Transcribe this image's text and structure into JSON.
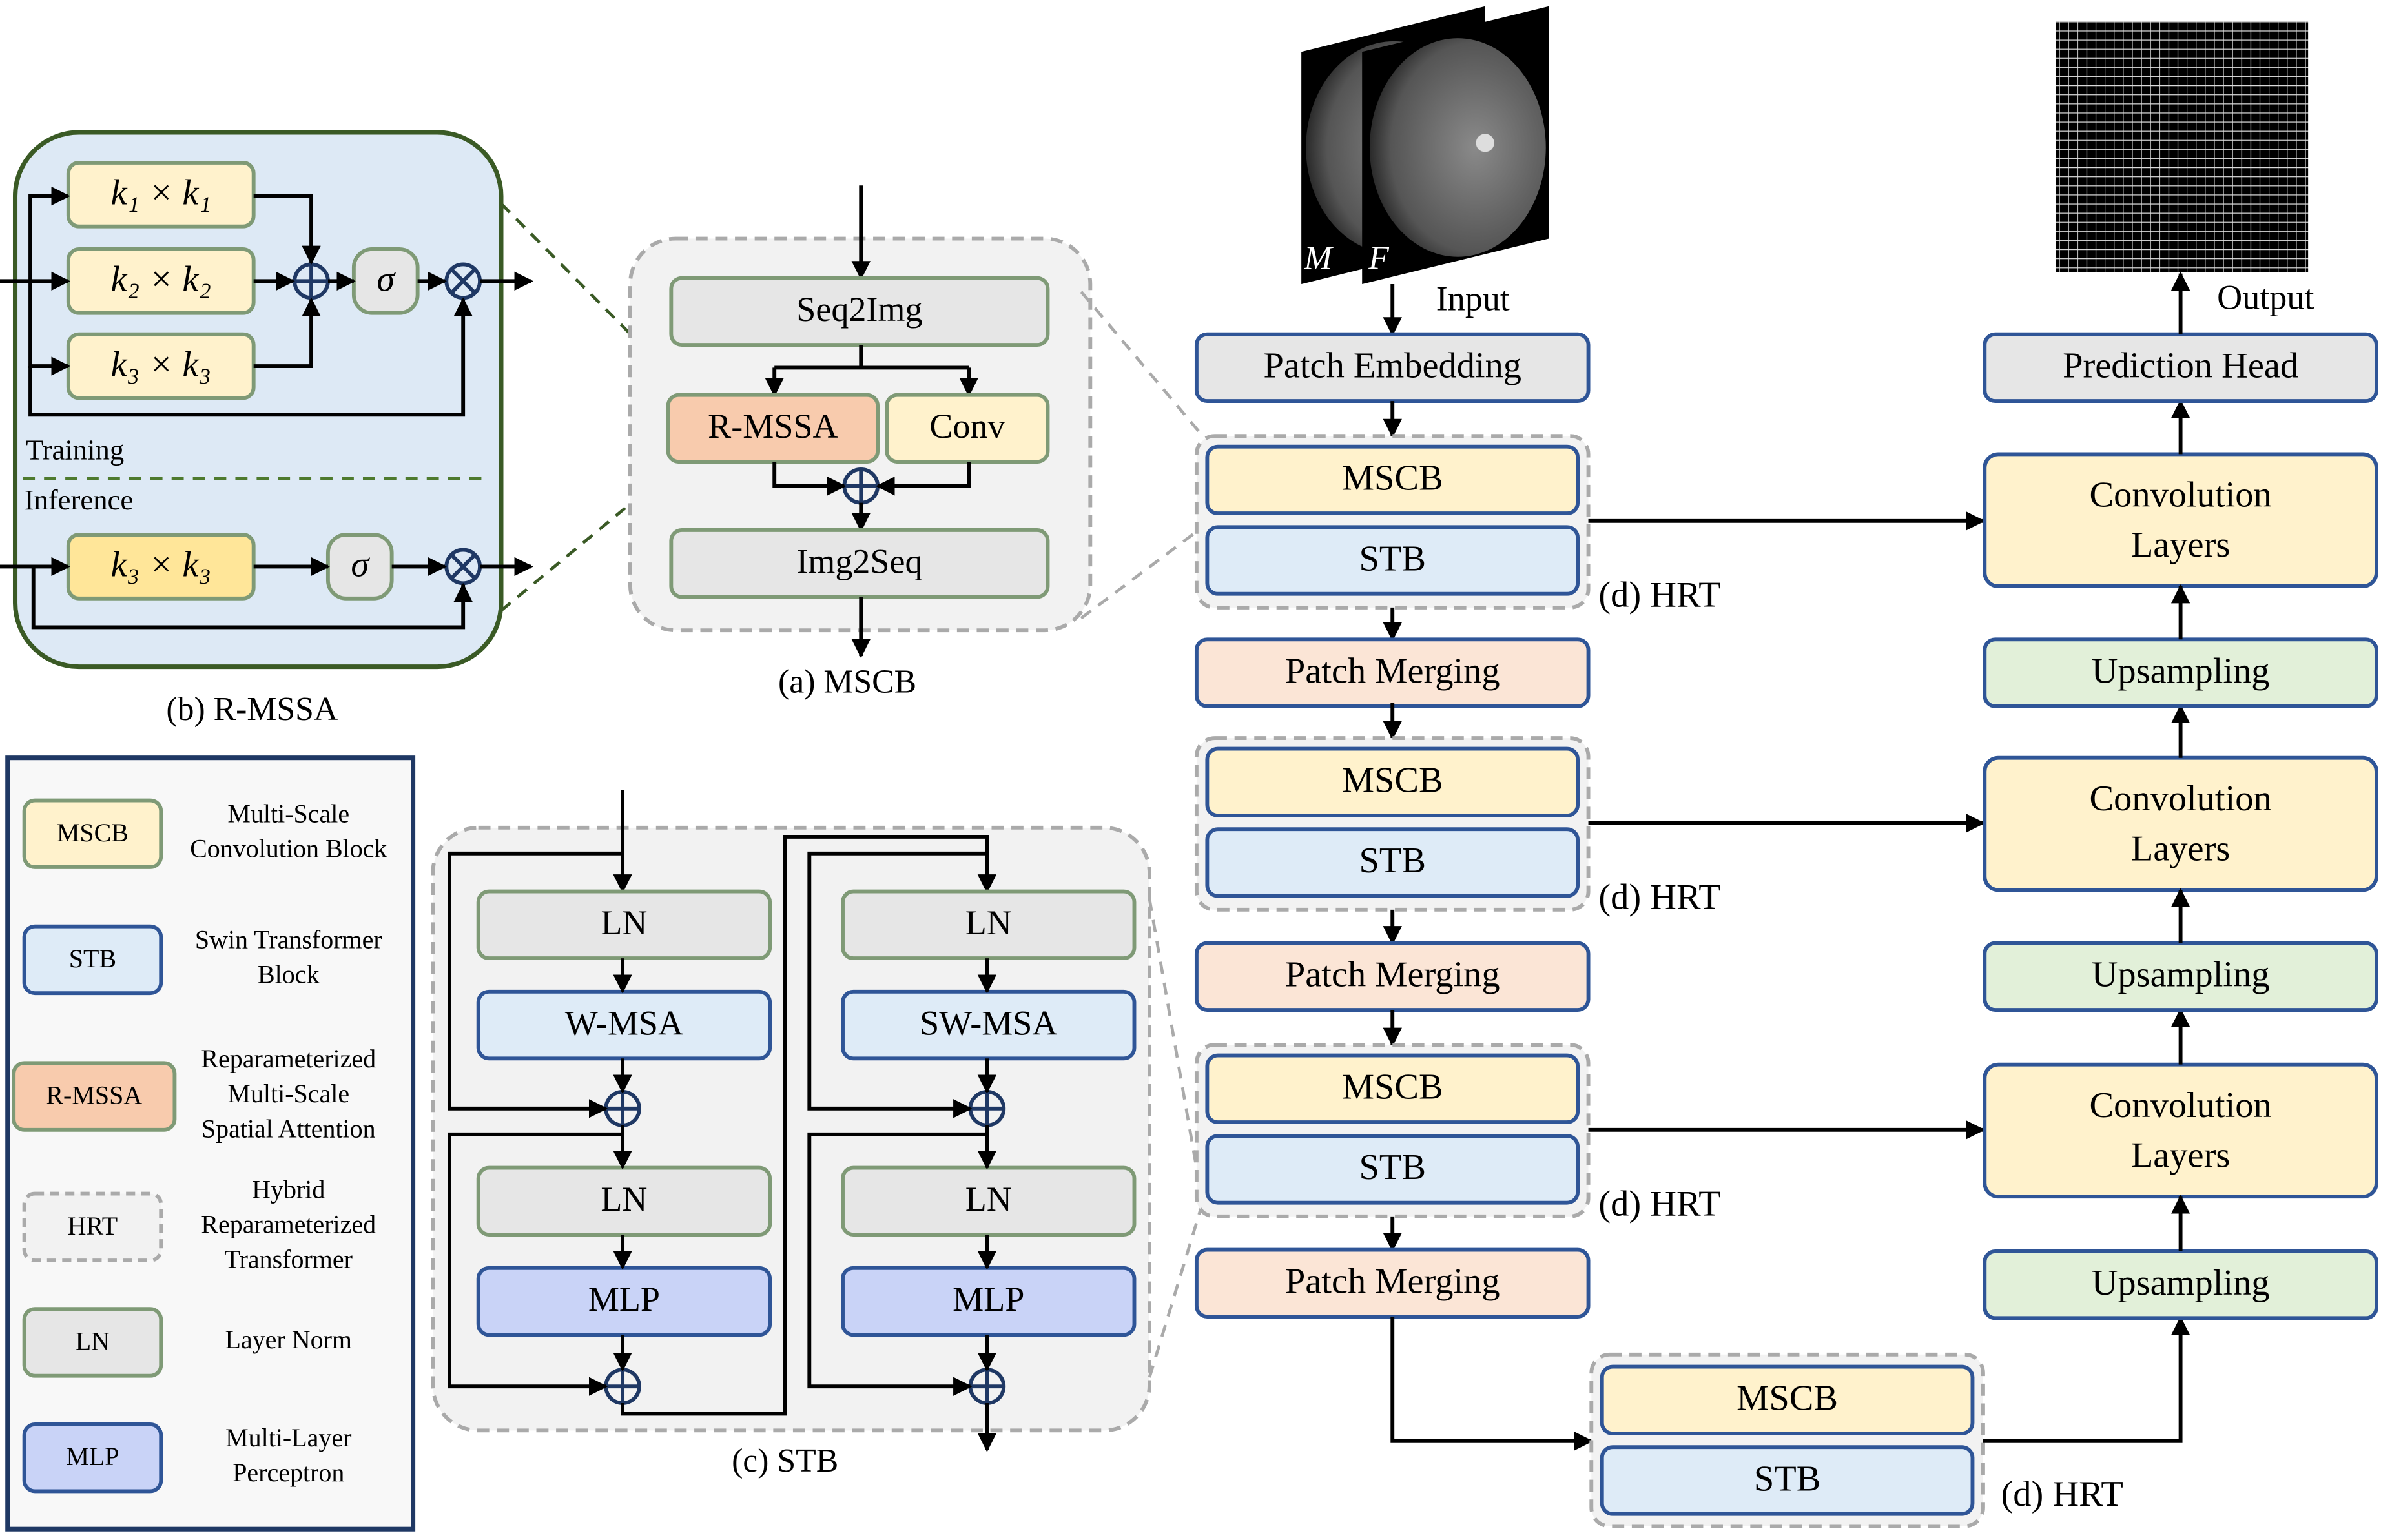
{
  "colors": {
    "yellow": "#fff2cc",
    "yellow_strong": "#ffe699",
    "gray": "#e6e6e6",
    "blue": "#deebf7",
    "orange": "#f8cbad",
    "pink": "#fbe5d6",
    "green": "#e2f0d9",
    "purple": "#c9d3f7",
    "panel_b_bg": "#dde9f5",
    "panel_b_border": "#3a5a25",
    "block_border": "#2f5597"
  },
  "rmssa": {
    "k1": "k₁ × k₁",
    "k2": "k₂ × k₂",
    "k3": "k₃ × k₃",
    "k3_inf": "k₃ × k₃",
    "sigma": "σ",
    "training": "Training",
    "inference": "Inference",
    "caption": "(b) R-MSSA"
  },
  "mscb": {
    "seq2img": "Seq2Img",
    "rmssa": "R-MSSA",
    "conv": "Conv",
    "img2seq": "Img2Seq",
    "caption": "(a) MSCB"
  },
  "stb": {
    "ln1": "LN",
    "wmsa": "W-MSA",
    "ln2": "LN",
    "mlp1": "MLP",
    "ln3": "LN",
    "swmsa": "SW-MSA",
    "ln4": "LN",
    "mlp2": "MLP",
    "caption": "(c) STB"
  },
  "legend": [
    {
      "abbr": "MSCB",
      "desc": [
        "Multi-Scale",
        "Convolution Block"
      ],
      "color": "yellow"
    },
    {
      "abbr": "STB",
      "desc": [
        "Swin Transformer",
        "Block"
      ],
      "color": "blue"
    },
    {
      "abbr": "R-MSSA",
      "desc": [
        "Reparameterized",
        "Multi-Scale",
        "Spatial Attention"
      ],
      "color": "orange"
    },
    {
      "abbr": "HRT",
      "desc": [
        "Hybrid",
        "Reparameterized",
        "Transformer"
      ],
      "color": "hrt"
    },
    {
      "abbr": "LN",
      "desc": [
        "Layer Norm"
      ],
      "color": "gray"
    },
    {
      "abbr": "MLP",
      "desc": [
        "Multi-Layer",
        "Perceptron"
      ],
      "color": "purple"
    }
  ],
  "network": {
    "input_label": "Input",
    "moving_label": "M",
    "fixed_label": "F",
    "output_label": "Output",
    "patch_embedding": "Patch Embedding",
    "prediction_head": "Prediction Head",
    "hrt_blocks": [
      {
        "mscb": "MSCB",
        "stb": "STB",
        "label": "(d) HRT"
      },
      {
        "mscb": "MSCB",
        "stb": "STB",
        "label": "(d) HRT"
      },
      {
        "mscb": "MSCB",
        "stb": "STB",
        "label": "(d) HRT"
      },
      {
        "mscb": "MSCB",
        "stb": "STB",
        "label": "(d) HRT"
      }
    ],
    "patch_merging": [
      "Patch Merging",
      "Patch Merging",
      "Patch Merging"
    ],
    "conv_layers": [
      [
        "Convolution",
        "Layers"
      ],
      [
        "Convolution",
        "Layers"
      ],
      [
        "Convolution",
        "Layers"
      ]
    ],
    "upsampling": [
      "Upsampling",
      "Upsampling",
      "Upsampling"
    ]
  }
}
